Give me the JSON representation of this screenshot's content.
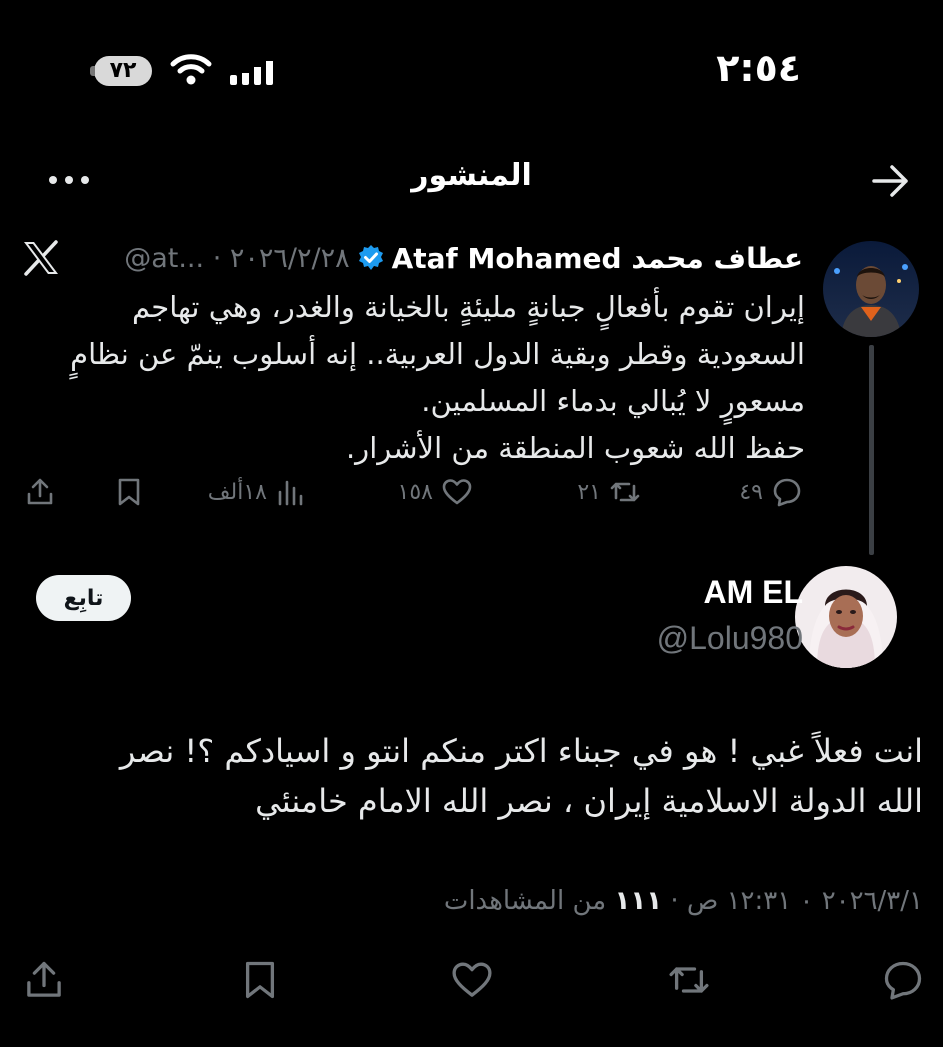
{
  "status_bar": {
    "time": "٢:٥٤",
    "battery": "٧٢",
    "wifi_icon": "wifi-icon",
    "signal_icon": "cellular-signal-icon"
  },
  "header": {
    "title": "المنشور",
    "back_icon": "arrow-right-icon",
    "more_icon": "more-horizontal-icon"
  },
  "quoted_post": {
    "author_name": "عطاف محمد Ataf Mohamed",
    "verified": true,
    "handle": "@at...",
    "date": "٢٠٢٦/٢/٢٨",
    "text": "إيران تقوم بأفعالٍ جبانةٍ مليئةٍ بالخيانة والغدر، وهي تهاجم\nالسعودية وقطر وبقية الدول العربية.. إنه أسلوب ينمّ عن نظامٍ\nمسعورٍ لا يُبالي بدماء المسلمين.\nحفظ الله شعوب المنطقة من الأشرار.",
    "stats": {
      "replies": "٤٩",
      "reposts": "٢١",
      "likes": "١٥٨",
      "views": "١٨ألف"
    }
  },
  "reply_post": {
    "author_name": "AM EL",
    "handle": "@Lolu980",
    "follow_label": "تابِع",
    "text": "انت فعلاً غبي ! هو في جبناء اكتر منكم انتو و اسيادكم ؟! نصر\nالله الدولة الاسلامية إيران ، نصر الله الامام خامنئي",
    "timestamp": "٢٠٢٦/٣/١ ٠ ١٢:٣١ ص",
    "views_count": "١١١",
    "views_label": "من المشاهدات"
  },
  "colors": {
    "background": "#000000",
    "text_primary": "#e7e9ea",
    "text_secondary": "#71767b",
    "verified_blue": "#1d9bf0"
  }
}
